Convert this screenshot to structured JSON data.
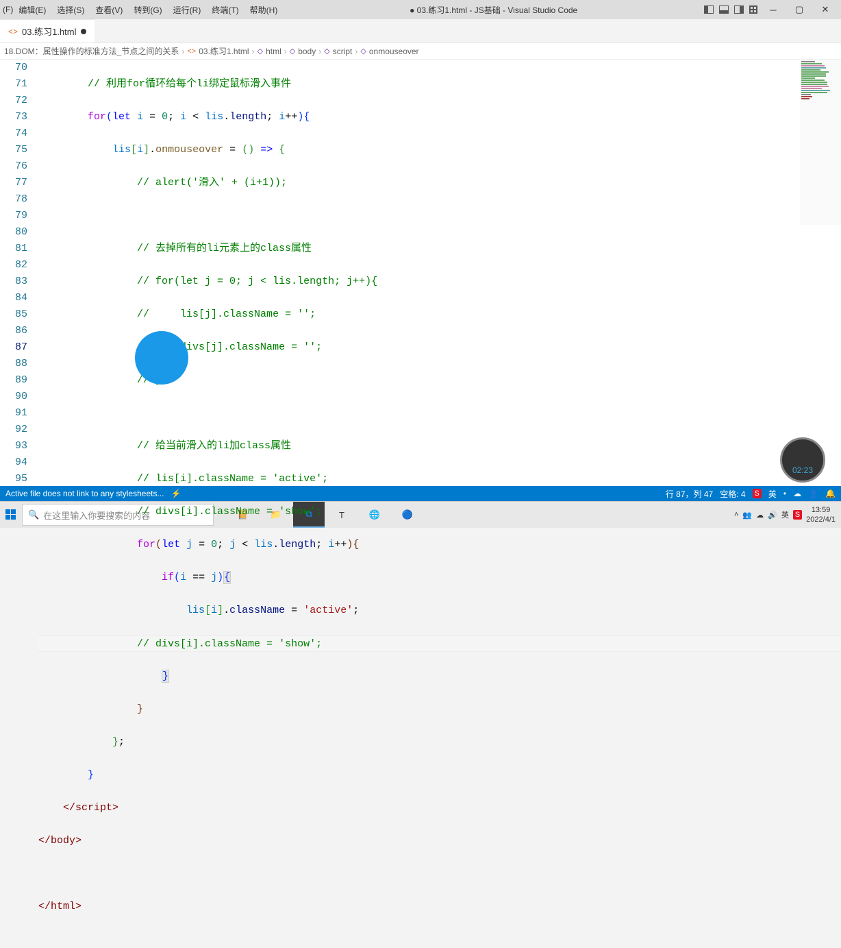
{
  "window": {
    "title_prefix": "● 03.练习1.html - JS基础 - Visual Studio Code",
    "left_label": "(F)"
  },
  "menu": {
    "edit": "编辑(E)",
    "select": "选择(S)",
    "view": "查看(V)",
    "goto": "转到(G)",
    "run": "运行(R)",
    "terminal": "终端(T)",
    "help": "帮助(H)"
  },
  "tab": {
    "name": "03.练习1.html"
  },
  "breadcrumb": {
    "b0": "18.DOM：属性操作的标准方法_节点之间的关系",
    "b1": "03.练习1.html",
    "b2": "html",
    "b3": "body",
    "b4": "script",
    "b5": "onmouseover"
  },
  "line_numbers": [
    "70",
    "71",
    "72",
    "73",
    "74",
    "75",
    "76",
    "77",
    "78",
    "79",
    "80",
    "81",
    "82",
    "83",
    "84",
    "85",
    "86",
    "87",
    "88",
    "89",
    "90",
    "91",
    "92",
    "93",
    "94",
    "95"
  ],
  "current_line_idx": 17,
  "code": {
    "l70": "// 利用for循环给每个li绑定鼠标滑入事件",
    "l71_for": "for",
    "l71_let": "let",
    "l71_i": "i",
    "l71_zero": "0",
    "l71_lis": "lis",
    "l71_length": "length",
    "l72_lis": "lis",
    "l72_i": "i",
    "l72_onmouseover": "onmouseover",
    "l73": "// alert('滑入' + (i+1));",
    "l75": "// 去掉所有的li元素上的class属性",
    "l76": "// for(let j = 0; j < lis.length; j++){",
    "l77": "//     lis[j].className = '';",
    "l78": "//     divs[j].className = '';",
    "l79": "// }",
    "l81": "// 给当前滑入的li加class属性",
    "l82": "// lis[i].className = 'active';",
    "l83": "// divs[i].className = 'show';",
    "l84_for": "for",
    "l84_let": "let",
    "l84_j": "j",
    "l84_zero": "0",
    "l84_lis": "lis",
    "l84_length": "length",
    "l84_i": "i",
    "l85_if": "if",
    "l85_i": "i",
    "l85_j": "j",
    "l86_lis": "lis",
    "l86_i": "i",
    "l86_className": "className",
    "l86_active": "'active'",
    "l87": "// divs[i].className = 'show';",
    "l92_script": "script",
    "l93_body": "body",
    "l95_html": "html"
  },
  "status": {
    "left": "Active file does not link to any stylesheets...",
    "line_col": "行 87，列 47",
    "spaces": "空格: 4",
    "ime_s": "S",
    "ime_lang": "英"
  },
  "taskbar": {
    "search_placeholder": "在这里输入你要搜索的内容",
    "time": "13:59",
    "date": "2022/4/1",
    "ime": "英",
    "ime_s": "S"
  },
  "record_time": "02:23"
}
